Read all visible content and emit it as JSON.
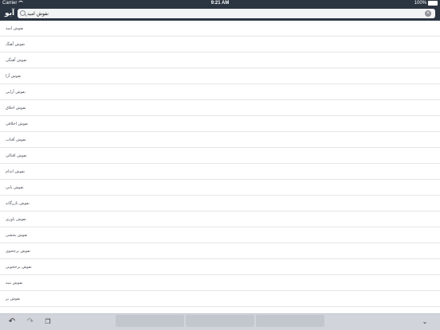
{
  "status_bar": {
    "carrier": "Carrier",
    "time": "9:21 AM",
    "battery": "100%"
  },
  "nav": {
    "logo": "آبو"
  },
  "search": {
    "value": "نفوش امید"
  },
  "results": [
    "نفوش امید",
    "نفوش آهنگ",
    "نفوش آهنگی",
    "نفوش آرا",
    "نفوش آرایی",
    "نفوش اخلاق",
    "نفوش اخلاقی",
    "نفوش آفتاب",
    "نفوش افتالی",
    "نفوش اندام",
    "نفوش بایی",
    "نفوش بازرگانه",
    "نفوش باوری",
    "نفوش بخشی",
    "نفوش برجخوی",
    "نفوش برجخویی",
    "نفوش بنیه",
    "نفوش بر"
  ],
  "keyboard": {
    "undo_icon": "undo-icon",
    "redo_icon": "redo-icon",
    "paste_icon": "paste-icon",
    "suggestions": [
      "",
      "",
      ""
    ],
    "dismiss_icon": "chevron-down-icon"
  }
}
